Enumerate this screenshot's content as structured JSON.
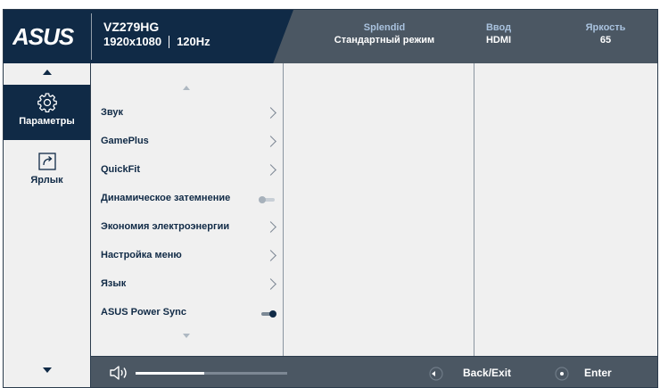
{
  "header": {
    "logo_text": "ASUS",
    "model": "VZ279HG",
    "resolution": "1920x1080",
    "refresh": "120Hz",
    "splendid": {
      "label": "Splendid",
      "value": "Стандартный режим"
    },
    "input": {
      "label": "Ввод",
      "value": "HDMI"
    },
    "brightness": {
      "label": "Яркость",
      "value": "65"
    }
  },
  "leftnav": {
    "items": [
      {
        "label": "Параметры",
        "icon": "gear-icon",
        "active": true
      },
      {
        "label": "Ярлык",
        "icon": "shortcut-icon",
        "active": false
      }
    ]
  },
  "menu": {
    "items": [
      {
        "label": "Звук",
        "control": "chevron"
      },
      {
        "label": "GamePlus",
        "control": "chevron"
      },
      {
        "label": "QuickFit",
        "control": "chevron"
      },
      {
        "label": "Динамическое затемнение",
        "control": "toggle",
        "on": false
      },
      {
        "label": "Экономия электроэнергии",
        "control": "chevron"
      },
      {
        "label": "Настройка меню",
        "control": "chevron"
      },
      {
        "label": "Язык",
        "control": "chevron"
      },
      {
        "label": "ASUS Power Sync",
        "control": "toggle",
        "on": true
      }
    ]
  },
  "footer": {
    "volume_level": 0.45,
    "back_label": "Back/Exit",
    "enter_label": "Enter"
  },
  "colors": {
    "header_dark": "#102a46",
    "header_gray": "#4b5763",
    "panel_bg": "#f0f0f0",
    "info_label": "#a9c2de"
  }
}
